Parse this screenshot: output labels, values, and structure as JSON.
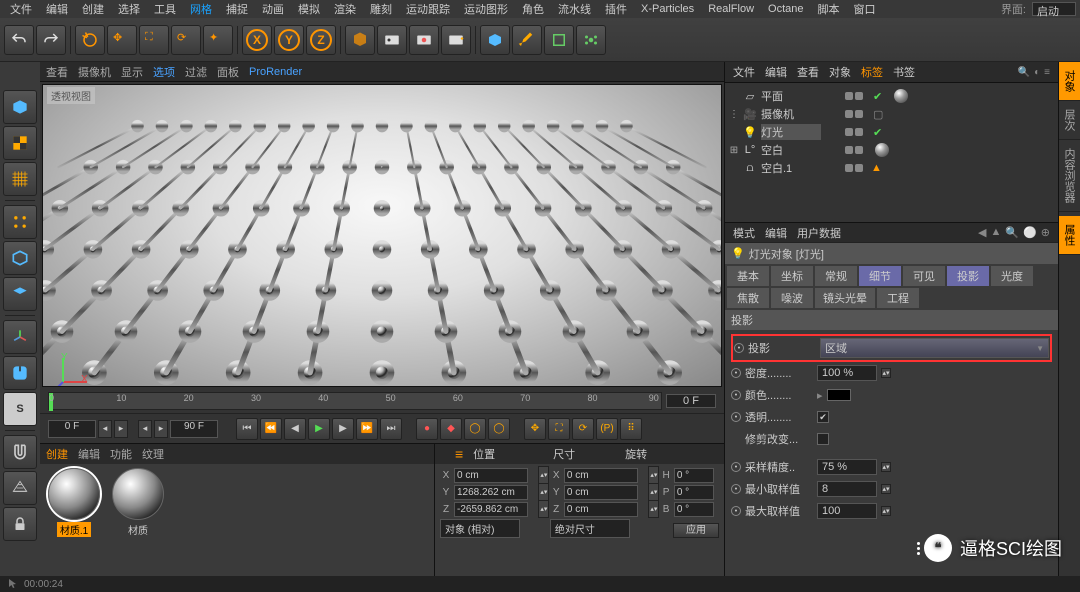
{
  "menubar": {
    "items": [
      "文件",
      "编辑",
      "创建",
      "选择",
      "工具",
      "网格",
      "捕捉",
      "动画",
      "模拟",
      "渲染",
      "雕刻",
      "运动跟踪",
      "运动图形",
      "角色",
      "流水线",
      "插件",
      "X-Particles",
      "RealFlow",
      "Octane",
      "脚本",
      "窗口"
    ],
    "highlight_index": 5,
    "ui_label": "界面:",
    "ui_value": "启动"
  },
  "viewport_menu": {
    "items": [
      "查看",
      "摄像机",
      "显示",
      "选项",
      "过滤",
      "面板",
      "ProRender"
    ],
    "highlight_index": 3,
    "label": "透视视图"
  },
  "axes": {
    "x": "X",
    "y": "Y"
  },
  "timeline": {
    "ticks": [
      "0",
      "10",
      "20",
      "30",
      "40",
      "50",
      "60",
      "70",
      "80",
      "90"
    ],
    "end": "0 F"
  },
  "transport": {
    "start": "0 F",
    "end": "90 F"
  },
  "materials": {
    "tabs": [
      "创建",
      "编辑",
      "功能",
      "纹理"
    ],
    "items": [
      {
        "name": "材质.1",
        "selected": true
      },
      {
        "name": "材质",
        "selected": false
      }
    ]
  },
  "coords": {
    "tab": "≡",
    "headers": [
      "位置",
      "尺寸",
      "旋转"
    ],
    "rows": [
      {
        "axis": "X",
        "pos": "0 cm",
        "sizeAxis": "X",
        "size": "0 cm",
        "rotAxis": "H",
        "rot": "0 °"
      },
      {
        "axis": "Y",
        "pos": "1268.262 cm",
        "sizeAxis": "Y",
        "size": "0 cm",
        "rotAxis": "P",
        "rot": "0 °"
      },
      {
        "axis": "Z",
        "pos": "-2659.862 cm",
        "sizeAxis": "Z",
        "size": "0 cm",
        "rotAxis": "B",
        "rot": "0 °"
      }
    ],
    "mode_pos": "对象 (相对)",
    "mode_size": "绝对尺寸",
    "apply": "应用"
  },
  "obj_panel": {
    "menus": [
      "文件",
      "编辑",
      "查看",
      "对象",
      "标签",
      "书签"
    ],
    "highlight_index": 4,
    "items": [
      {
        "icon": "plane",
        "name": "平面",
        "tags": [
          "dots",
          "check",
          "mat"
        ]
      },
      {
        "icon": "camera",
        "name": "摄像机",
        "tags": [
          "dots",
          "check2"
        ]
      },
      {
        "icon": "light",
        "name": "灯光",
        "selected": true,
        "tags": [
          "dots",
          "check"
        ]
      },
      {
        "icon": "null",
        "name": "空白",
        "expander": "+",
        "prefix": "L°",
        "tags": [
          "dots",
          "mat"
        ]
      },
      {
        "icon": "null",
        "name": "空白.1",
        "prefix": "⩍",
        "tags": [
          "dots",
          "tri"
        ]
      }
    ]
  },
  "attr_panel": {
    "menus": [
      "模式",
      "编辑",
      "用户数据"
    ],
    "heading": "灯光对象 [灯光]",
    "tabs": [
      "基本",
      "坐标",
      "常规",
      "细节",
      "可见",
      "投影",
      "光度",
      "焦散",
      "噪波",
      "镜头光晕",
      "工程"
    ],
    "tab_row1_count": 6,
    "selected_tabs": [
      3,
      5
    ],
    "section": "投影",
    "rows": [
      {
        "type": "combo",
        "label": "投影",
        "value": "区域",
        "highlighted": true
      },
      {
        "type": "num",
        "label": "密度",
        "suffix": "........",
        "value": "100 %"
      },
      {
        "type": "color",
        "label": "颜色",
        "suffix": "........"
      },
      {
        "type": "check",
        "label": "透明",
        "suffix": "........",
        "checked": true
      },
      {
        "type": "check",
        "label": "修剪改变",
        "suffix": "...",
        "checked": false,
        "no_bullet": true
      },
      {
        "type": "num",
        "label": "采样精度",
        "suffix": "..",
        "value": "75 %"
      },
      {
        "type": "num",
        "label": "最小取样值",
        "value": "8"
      },
      {
        "type": "num",
        "label": "最大取样值",
        "value": "100"
      }
    ]
  },
  "right_tabs": [
    "对象",
    "层次",
    "内容浏览器",
    "属性"
  ],
  "status": {
    "time": "00:00:24"
  },
  "watermark": "逼格SCI绘图"
}
